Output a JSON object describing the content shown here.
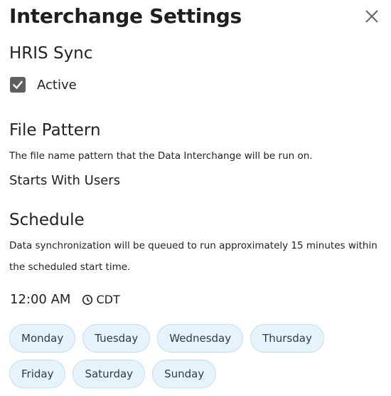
{
  "dialog": {
    "title": "Interchange Settings",
    "close_icon": "close-icon"
  },
  "sync": {
    "title": "HRIS Sync",
    "active_label": "Active",
    "active_checked": true
  },
  "file_pattern": {
    "title": "File Pattern",
    "description": "The file name pattern that the Data Interchange will be run on.",
    "value": "Starts With Users"
  },
  "schedule": {
    "title": "Schedule",
    "description": "Data synchronization will be queued to run approximately 15 minutes within the scheduled start time.",
    "time": "12:00 AM",
    "timezone": "CDT",
    "timezone_icon": "clock-icon",
    "days": [
      "Monday",
      "Tuesday",
      "Wednesday",
      "Thursday",
      "Friday",
      "Saturday",
      "Sunday"
    ]
  },
  "colors": {
    "chip_background": "#e6f3fb",
    "chip_border": "#bfe0f2",
    "checkbox": "#5f5f5f"
  }
}
